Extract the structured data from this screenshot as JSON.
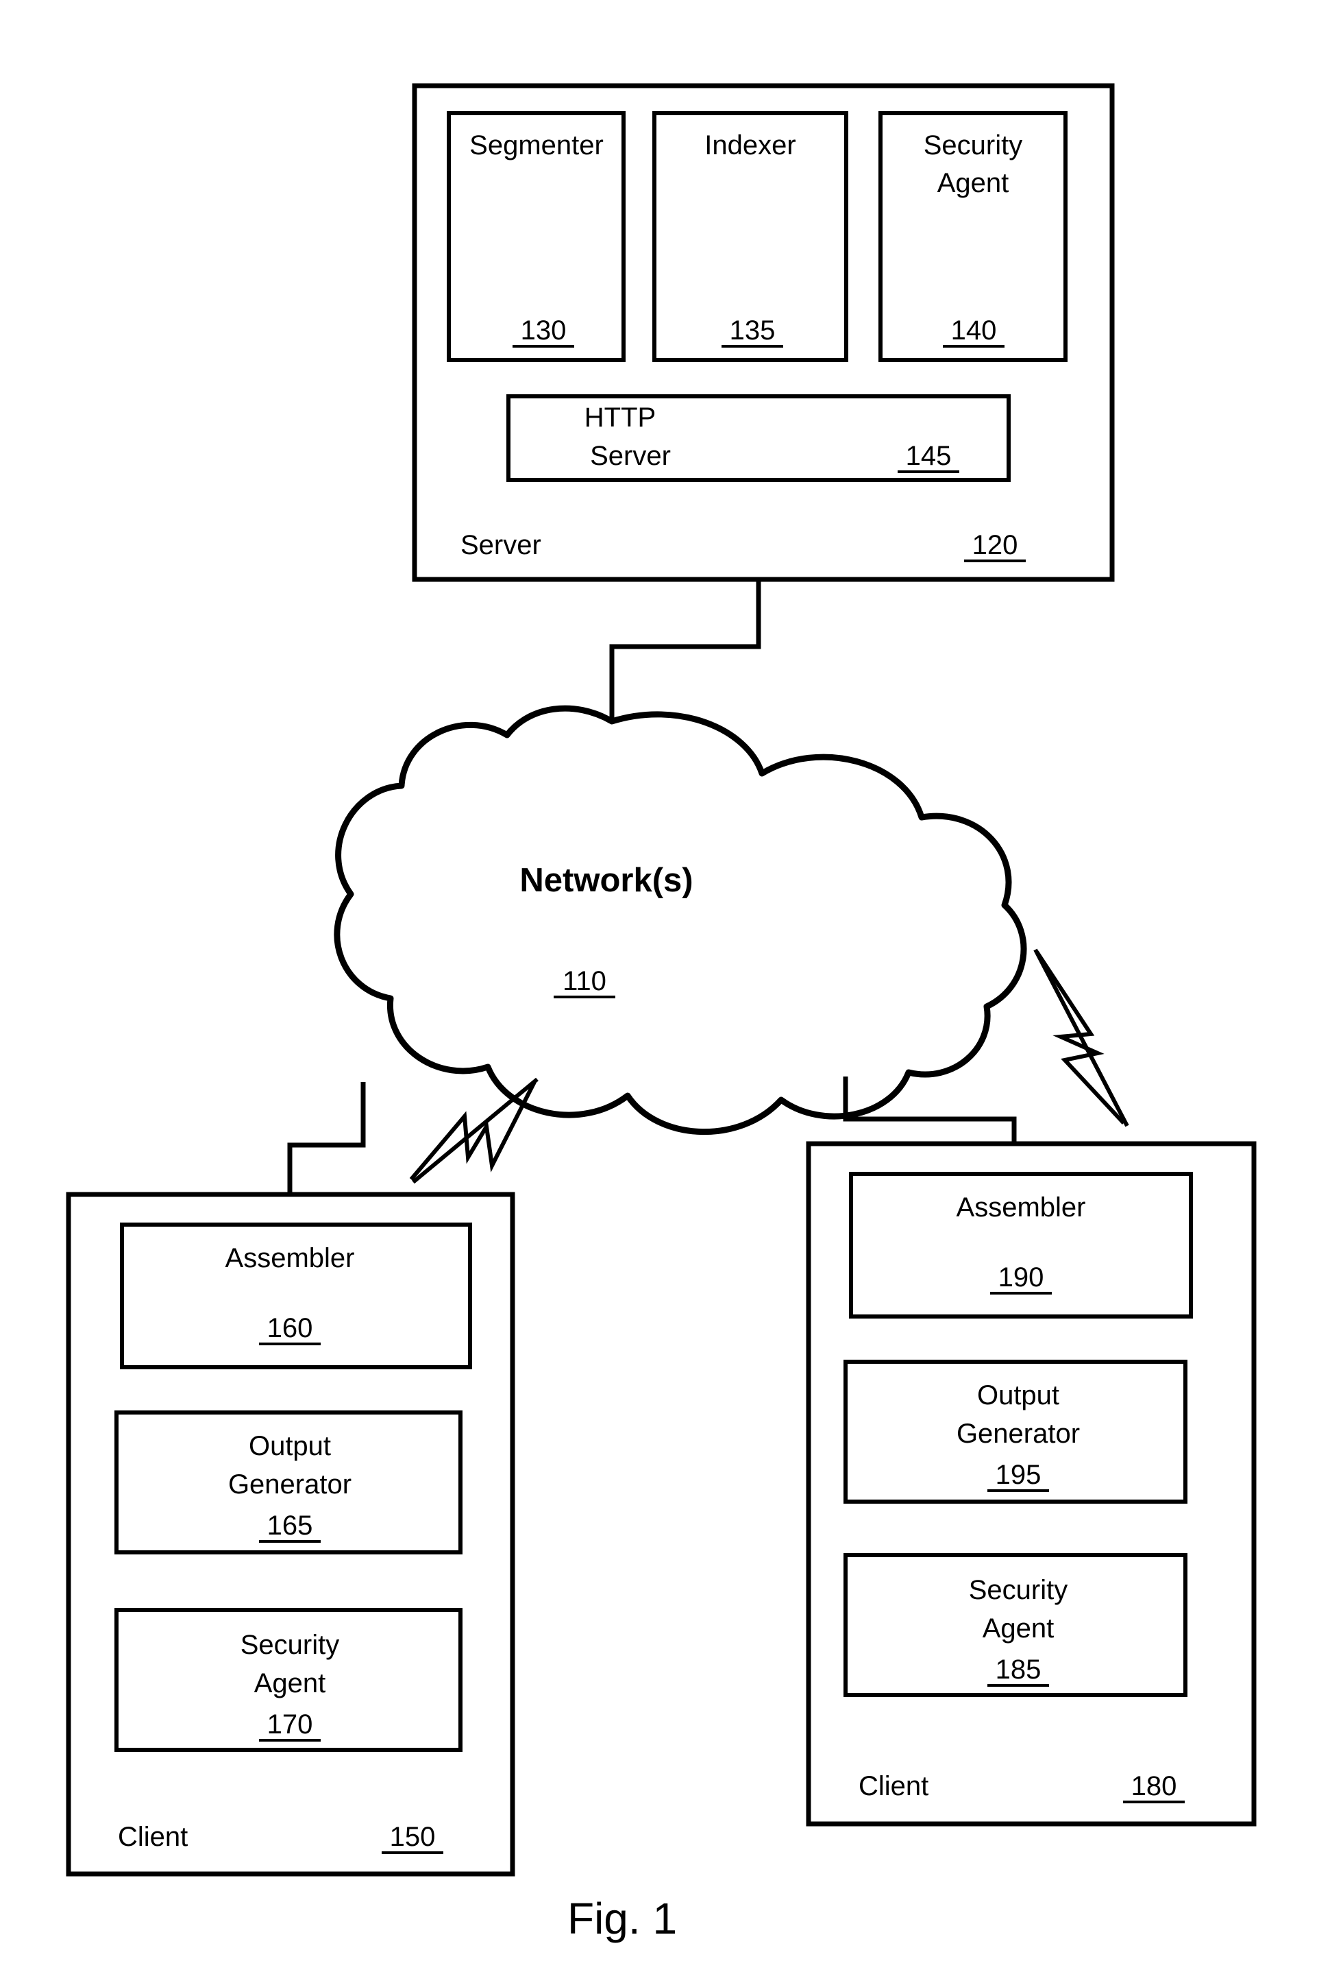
{
  "figure": {
    "caption": "Fig. 1",
    "title": "Fig. 1"
  },
  "server": {
    "name": "server-container",
    "label": "Server",
    "ref": "120",
    "modules": [
      {
        "label": "Segmenter",
        "ref": "130",
        "name": "segmenter"
      },
      {
        "label": "Indexer",
        "ref": "135",
        "name": "indexer"
      },
      {
        "label": "Security Agent",
        "label_line1": "Security",
        "label_line2": "Agent",
        "ref": "140",
        "name": "security-agent"
      }
    ],
    "http_server": {
      "label_line1": "HTTP",
      "label_line2": "Server",
      "ref": "145",
      "name": "http-server"
    }
  },
  "network": {
    "label": "Network(s)",
    "ref": "110",
    "name": "network-cloud"
  },
  "client_left": {
    "label": "Client",
    "ref": "150",
    "name": "client-left",
    "modules": [
      {
        "label": "Assembler",
        "ref": "160",
        "name": "assembler"
      },
      {
        "label_line1": "Output",
        "label_line2": "Generator",
        "ref": "165",
        "name": "output-generator"
      },
      {
        "label_line1": "Security",
        "label_line2": "Agent",
        "ref": "170",
        "name": "security-agent"
      }
    ]
  },
  "client_right": {
    "label": "Client",
    "ref": "180",
    "name": "client-right",
    "modules": [
      {
        "label": "Assembler",
        "ref": "190",
        "name": "assembler"
      },
      {
        "label_line1": "Output",
        "label_line2": "Generator",
        "ref": "195",
        "name": "output-generator"
      },
      {
        "label_line1": "Security",
        "label_line2": "Agent",
        "ref": "185",
        "name": "security-agent"
      }
    ]
  },
  "connectors": {
    "server_to_cloud": "server-to-network-link",
    "cloud_to_client_left": "network-to-client-left-link",
    "cloud_to_client_right": "network-to-client-right-link"
  },
  "wireless_symbols": [
    {
      "name": "wireless-link-left"
    },
    {
      "name": "wireless-link-right"
    }
  ],
  "colors": {
    "line": "#000000",
    "fill": "#ffffff"
  }
}
